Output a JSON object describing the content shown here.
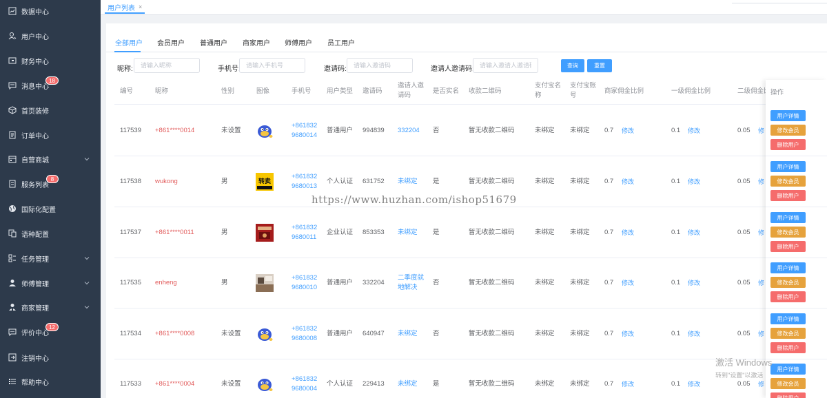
{
  "sidebar": {
    "items": [
      {
        "label": "数据中心",
        "icon": "chart-icon"
      },
      {
        "label": "用户中心",
        "icon": "user-icon"
      },
      {
        "label": "财务中心",
        "icon": "wallet-icon"
      },
      {
        "label": "消息中心",
        "icon": "message-icon",
        "badge": "18"
      },
      {
        "label": "首页装修",
        "icon": "cube-icon"
      },
      {
        "label": "订单中心",
        "icon": "document-icon"
      },
      {
        "label": "自营商城",
        "icon": "store-icon",
        "expandable": true
      },
      {
        "label": "服务列表",
        "icon": "list-icon",
        "badge": "8"
      },
      {
        "label": "国际化配置",
        "icon": "globe-icon"
      },
      {
        "label": "语种配置",
        "icon": "language-icon"
      },
      {
        "label": "任务管理",
        "icon": "tasks-icon",
        "expandable": true
      },
      {
        "label": "师傅管理",
        "icon": "person-icon",
        "expandable": true
      },
      {
        "label": "商家管理",
        "icon": "merchant-icon",
        "expandable": true
      },
      {
        "label": "评价中心",
        "icon": "comment-icon",
        "badge": "12"
      },
      {
        "label": "注销中心",
        "icon": "logout-icon"
      },
      {
        "label": "帮助中心",
        "icon": "help-list-icon"
      }
    ]
  },
  "topbar": {
    "tab_label": "用户列表",
    "close": "×"
  },
  "subtabs": [
    "全部用户",
    "会员用户",
    "普通用户",
    "商家用户",
    "师傅用户",
    "员工用户"
  ],
  "filters": {
    "nickname": {
      "label": "昵称:",
      "placeholder": "请输入昵称"
    },
    "phone": {
      "label": "手机号:",
      "placeholder": "请输入手机号"
    },
    "invite": {
      "label": "邀请码:",
      "placeholder": "请输入邀请码"
    },
    "inviter": {
      "label": "邀请人邀请码:",
      "placeholder": "请输入邀请人邀请码"
    },
    "search_label": "查询",
    "reset_label": "重置"
  },
  "table": {
    "headers": {
      "id": "编号",
      "nickname": "昵称",
      "gender": "性别",
      "avatar": "图像",
      "phone": "手机号",
      "user_type": "用户类型",
      "invite_code": "邀请码",
      "inviter_1": "邀请人邀",
      "inviter_2": "请码",
      "realname": "是否实名",
      "qrcode": "收款二维码",
      "alipay_name_1": "支付宝名",
      "alipay_name_2": "称",
      "alipay_acct_1": "支付宝账",
      "alipay_acct_2": "号",
      "merchant_ratio": "商家佣金比例",
      "level1_ratio": "一级佣金比例",
      "level2_ratio": "二级佣金比",
      "op": "操作"
    },
    "rows": [
      {
        "id": "117539",
        "nickname": "+861****0014",
        "gender": "未设置",
        "avatar": "blue-mascot",
        "phone_1": "+861832",
        "phone_2": "9680014",
        "user_type": "普通用户",
        "invite_code": "994839",
        "inviter_1": "332204",
        "inviter_2": "",
        "realname": "否",
        "qrcode": "暂无收款二维码",
        "alipay_name": "未绑定",
        "alipay_acct": "未绑定",
        "merchant_ratio": "0.7",
        "level1_ratio": "0.1",
        "level2_ratio": "0.05"
      },
      {
        "id": "117538",
        "nickname": "wukong",
        "gender": "男",
        "avatar": "zhuanmai-logo",
        "avatar_text": "转卖",
        "phone_1": "+861832",
        "phone_2": "9680013",
        "user_type": "个人认证",
        "invite_code": "631752",
        "inviter_1": "未绑定",
        "inviter_2": "",
        "realname": "是",
        "qrcode": "暂无收款二维码",
        "alipay_name": "未绑定",
        "alipay_acct": "未绑定",
        "merchant_ratio": "0.7",
        "level1_ratio": "0.1",
        "level2_ratio": "0.05"
      },
      {
        "id": "117537",
        "nickname": "+861****0011",
        "gender": "男",
        "avatar": "red-poster",
        "phone_1": "+861832",
        "phone_2": "9680011",
        "user_type": "企业认证",
        "invite_code": "853353",
        "inviter_1": "未绑定",
        "inviter_2": "",
        "realname": "是",
        "qrcode": "暂无收款二维码",
        "alipay_name": "未绑定",
        "alipay_acct": "未绑定",
        "merchant_ratio": "0.7",
        "level1_ratio": "0.1",
        "level2_ratio": "0.05"
      },
      {
        "id": "117535",
        "nickname": "enheng",
        "gender": "男",
        "avatar": "photo",
        "phone_1": "+861832",
        "phone_2": "9680010",
        "user_type": "普通用户",
        "invite_code": "332204",
        "inviter_1": "二季度就",
        "inviter_2": "地解决",
        "realname": "否",
        "qrcode": "暂无收款二维码",
        "alipay_name": "未绑定",
        "alipay_acct": "未绑定",
        "merchant_ratio": "0.7",
        "level1_ratio": "0.1",
        "level2_ratio": "0.05"
      },
      {
        "id": "117534",
        "nickname": "+861****0008",
        "gender": "未设置",
        "avatar": "blue-mascot",
        "phone_1": "+861832",
        "phone_2": "9680008",
        "user_type": "普通用户",
        "invite_code": "640947",
        "inviter_1": "未绑定",
        "inviter_2": "",
        "realname": "否",
        "qrcode": "暂无收款二维码",
        "alipay_name": "未绑定",
        "alipay_acct": "未绑定",
        "merchant_ratio": "0.7",
        "level1_ratio": "0.1",
        "level2_ratio": "0.05"
      },
      {
        "id": "117533",
        "nickname": "+861****0004",
        "gender": "未设置",
        "avatar": "blue-mascot",
        "phone_1": "+861832",
        "phone_2": "9680004",
        "user_type": "个人认证",
        "invite_code": "229413",
        "inviter_1": "未绑定",
        "inviter_2": "",
        "realname": "是",
        "qrcode": "暂无收款二维码",
        "alipay_name": "未绑定",
        "alipay_acct": "未绑定",
        "merchant_ratio": "0.7",
        "level1_ratio": "0.1",
        "level2_ratio": "0.05"
      }
    ],
    "edit_label": "修改",
    "level2_edit_label": "修",
    "actions": {
      "detail": "用户详情",
      "member": "修改会员",
      "delete": "删除用户"
    }
  },
  "watermark": "https://www.huzhan.com/ishop51679",
  "activate": {
    "line1": "激活 Windows",
    "line2": "转到\"设置\"以激活"
  },
  "colors": {
    "sidebar_bg": "#2d3a4b",
    "primary": "#409eff",
    "warning": "#e6a23c",
    "danger": "#f56c6c",
    "nickname": "#e15a5a"
  }
}
